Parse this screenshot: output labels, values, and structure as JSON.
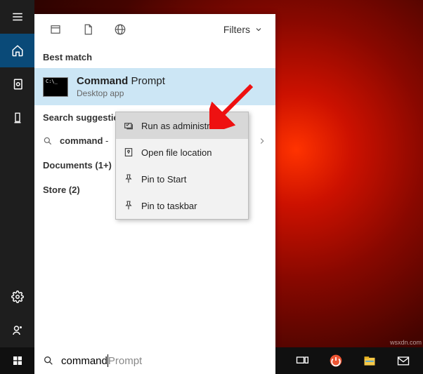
{
  "sidebar": {
    "items": [
      "menu",
      "home",
      "clock",
      "tower"
    ],
    "bottom": [
      "settings",
      "user"
    ]
  },
  "panel": {
    "filters_label": "Filters",
    "best_match_label": "Best match",
    "best_match": {
      "title_bold": "Command",
      "title_rest": " Prompt",
      "subtitle": "Desktop app",
      "thumb_text": "C:\\_"
    },
    "suggestions_label": "Search suggestions",
    "suggestion_prefix": "command",
    "suggestion_rest": " -",
    "documents_label": "Documents (1+)",
    "store_label": "Store (2)"
  },
  "context_menu": {
    "items": [
      "Run as administrator",
      "Open file location",
      "Pin to Start",
      "Pin to taskbar"
    ]
  },
  "search": {
    "typed": "command",
    "placeholder": "Prompt"
  },
  "watermark": "wsxdn.com"
}
